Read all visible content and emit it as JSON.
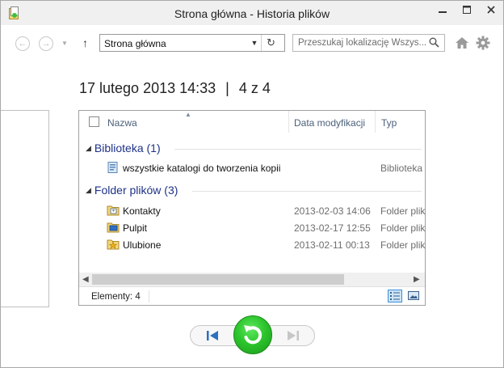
{
  "window": {
    "title": "Strona główna - Historia plików"
  },
  "address": {
    "path": "Strona główna"
  },
  "search": {
    "placeholder": "Przeszukaj lokalizację Wszys..."
  },
  "backup": {
    "date": "17 lutego 2013 14:33",
    "separator": "|",
    "position": "4 z 4"
  },
  "columns": {
    "name": "Nazwa",
    "modified": "Data modyfikacji",
    "type": "Typ"
  },
  "groups": [
    {
      "label": "Biblioteka (1)",
      "items": [
        {
          "name": "wszystkie katalogi do tworzenia kopii",
          "modified": "",
          "type": "Biblioteka",
          "icon": "library-icon"
        }
      ]
    },
    {
      "label": "Folder plików (3)",
      "items": [
        {
          "name": "Kontakty",
          "modified": "2013-02-03 14:06",
          "type": "Folder plik",
          "icon": "contacts-folder-icon"
        },
        {
          "name": "Pulpit",
          "modified": "2013-02-17 12:55",
          "type": "Folder plik",
          "icon": "desktop-folder-icon"
        },
        {
          "name": "Ulubione",
          "modified": "2013-02-11 00:13",
          "type": "Folder plik",
          "icon": "favorites-folder-icon"
        }
      ]
    }
  ],
  "status": {
    "items": "Elementy: 4"
  },
  "colors": {
    "accent": "#1e3287",
    "restore": "#2dc52d",
    "selected_view": "#cce4f7"
  }
}
